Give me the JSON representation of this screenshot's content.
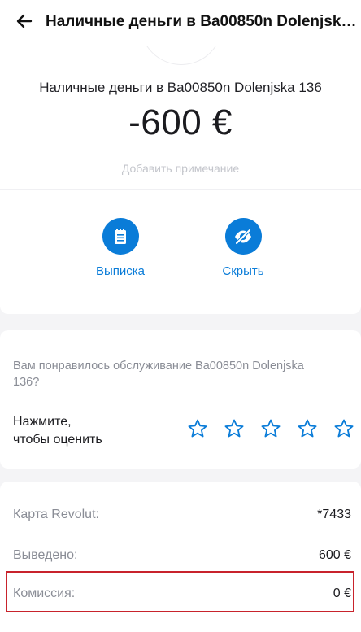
{
  "header": {
    "title": "Наличные деньги в Ba00850n Dolenjska 136"
  },
  "transaction": {
    "merchant": "Наличные деньги в Ba00850n Dolenjska 136",
    "amount": "-600 €",
    "note_placeholder": "Добавить примечание"
  },
  "actions": [
    {
      "label": "Выписка",
      "icon": "statement-icon"
    },
    {
      "label": "Скрыть",
      "icon": "hide-eye-icon"
    }
  ],
  "rating": {
    "question": "Вам понравилось обслуживание Ba00850n Dolenjska 136?",
    "hint": "Нажмите,\nчтобы оценить",
    "stars_total": 5,
    "stars_selected": 0
  },
  "details": [
    {
      "label": "Карта Revolut:",
      "value": "*7433"
    },
    {
      "label": "Выведено:",
      "value": "600 €"
    },
    {
      "label": "Комиссия:",
      "value": "0 €"
    }
  ],
  "colors": {
    "accent": "#0a7cd8",
    "highlight": "#c8232c",
    "muted_text": "#8a8d96"
  }
}
